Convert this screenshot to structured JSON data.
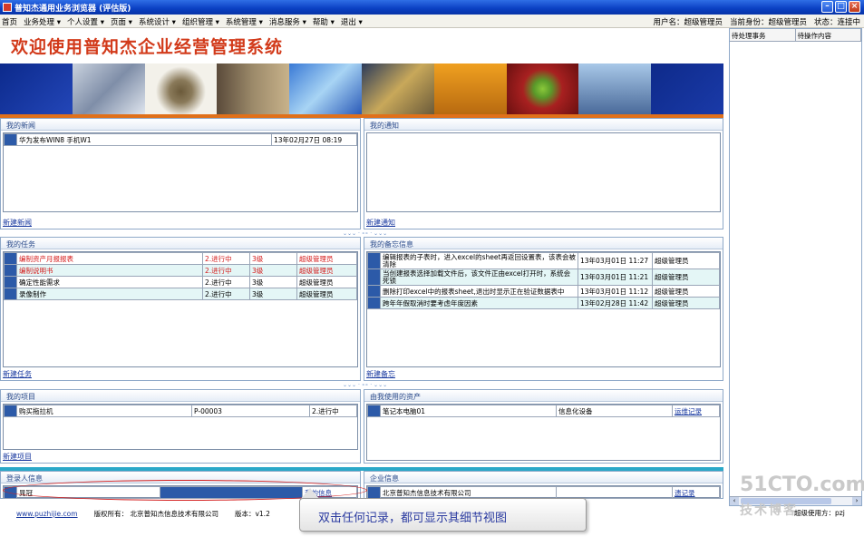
{
  "window": {
    "title": "普知杰通用业务浏览器 (评估版)"
  },
  "menubar": {
    "items": [
      "首页",
      "业务处理 ▾",
      "个人设置 ▾",
      "页面 ▾",
      "系统设计 ▾",
      "组织管理 ▾",
      "系统管理 ▾",
      "消息服务 ▾",
      "帮助 ▾",
      "退出 ▾"
    ],
    "status": [
      "用户名：超级管理员",
      "当前身份：超级管理员",
      "状态：连接中"
    ]
  },
  "banner": {
    "title": "欢迎使用普知杰企业经营管理系统"
  },
  "panels": {
    "news": {
      "title": "我的新闻",
      "footer": "新建新闻",
      "rows": [
        [
          "华为发布WIN8 手机W1",
          "13年02月27日 08:19"
        ]
      ]
    },
    "notice": {
      "title": "我的通知",
      "footer": "新建通知"
    },
    "tasks": {
      "title": "我的任务",
      "footer": "新建任务",
      "rows": [
        [
          "编制资产月报报表",
          "2.进行中",
          "3级",
          "超级管理员"
        ],
        [
          "编制说明书",
          "2.进行中",
          "3级",
          "超级管理员"
        ],
        [
          "确定性能需求",
          "2.进行中",
          "3级",
          "超级管理员"
        ],
        [
          "录像制作",
          "2.进行中",
          "3级",
          "超级管理员"
        ]
      ]
    },
    "memo": {
      "title": "我的备忘信息",
      "footer": "新建备忘",
      "rows": [
        [
          "编辑报表的子表时，进入excel的sheet再返回设置表，该表会被清除",
          "13年03月01日 11:27",
          "超级管理员"
        ],
        [
          "当创建报表选择加载文件后，该文件正由excel打开时，系统会死锁",
          "13年03月01日 11:21",
          "超级管理员"
        ],
        [
          "删除打印excel中的报表sheet,退出时显示正在验证数据表中",
          "13年03月01日 11:12",
          "超级管理员"
        ],
        [
          "跨年年假取消时要考虑年度因素",
          "13年02月28日 11:42",
          "超级管理员"
        ]
      ]
    },
    "projects": {
      "title": "我的项目",
      "footer": "新建项目",
      "rows": [
        [
          "购买拖拉机",
          "P-00003",
          "2.进行中"
        ]
      ]
    },
    "assets": {
      "title": "由我使用的资产",
      "rows": [
        [
          "笔记本电脑01",
          "信息化设备",
          "运维记录"
        ]
      ]
    },
    "login": {
      "title": "登录人信息",
      "rows": [
        [
          "晁冠",
          "",
          "我的信息"
        ]
      ]
    },
    "company": {
      "title": "企业信息",
      "rows": [
        [
          "北京普知杰信息技术有限公司",
          "",
          "遗记录"
        ]
      ]
    }
  },
  "right_pane": {
    "headers": [
      "待处理事务",
      "待操作内容"
    ]
  },
  "footer": {
    "url": "www.puzhijie.com",
    "copyright": "版权所有： 北京普知杰信息技术有限公司",
    "version": "版本：v1.2"
  },
  "watermark": {
    "main": "51CTO.com",
    "sub": "技术博客"
  },
  "admin_user": "超级使用方：pzj",
  "callout": {
    "text": "双击任何记录，都可显示其细节视图"
  },
  "divider": "⌄⌄⌄ · ∘∘ · ⌄⌄⌄"
}
